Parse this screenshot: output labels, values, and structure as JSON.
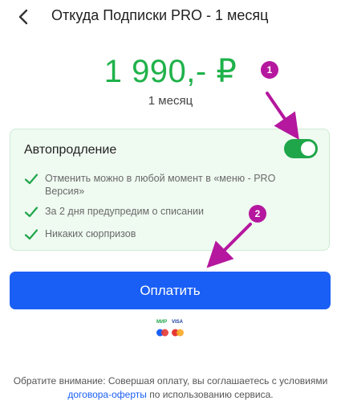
{
  "header": {
    "title": "Откуда Подписки PRO - 1 месяц",
    "back_icon": "chevron-left-icon"
  },
  "plan": {
    "price": "1 990,- ₽",
    "period": "1 месяц"
  },
  "autorenew": {
    "label": "Автопродление",
    "enabled": true,
    "features": [
      {
        "line1": "Отменить можно в любой момент в «меню - PRO",
        "line2": "Версия»"
      },
      {
        "line1": "За 2 дня предупредим о списании",
        "line2": ""
      },
      {
        "line1": "Никаких сюрпризов",
        "line2": ""
      }
    ]
  },
  "pay": {
    "label": "Оплатить"
  },
  "payment_logos": {
    "mir": "МИР",
    "visa": "VISA"
  },
  "notice": {
    "before": "Обратите внимание: Совершая оплату, вы соглашаетесь с условиями ",
    "link": "договора-оферты",
    "after": " по использованию сервиса."
  },
  "annotations": {
    "badge1": "1",
    "badge2": "2"
  },
  "colors": {
    "accent": "#1a5ff5",
    "price": "#1fb24a",
    "toggle": "#1fa64a",
    "annotation": "#b5179e"
  }
}
